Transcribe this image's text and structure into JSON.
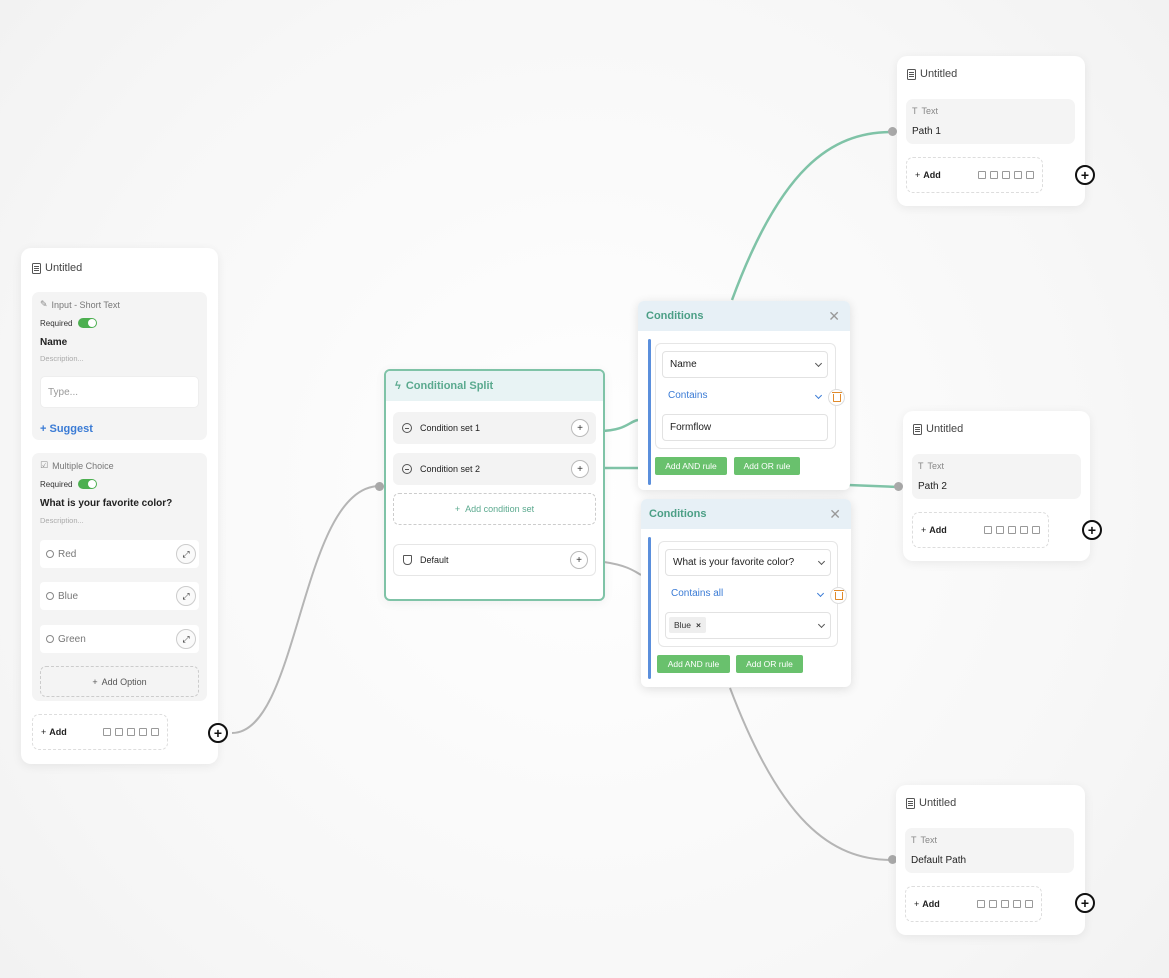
{
  "left_card": {
    "title": "Untitled",
    "input_block": {
      "type_label": "Input - Short Text",
      "required_label": "Required",
      "field_name": "Name",
      "description_placeholder": "Description...",
      "answer_placeholder": "Type...",
      "suggest_label": "+ Suggest"
    },
    "choice_block": {
      "type_label": "Multiple Choice",
      "required_label": "Required",
      "question": "What is your favorite color?",
      "description_placeholder": "Description...",
      "options": [
        "Red",
        "Blue",
        "Green"
      ],
      "add_option_label": "Add Option"
    },
    "add_label": "Add"
  },
  "split": {
    "title": "Conditional Split",
    "condition_sets": [
      "Condition set 1",
      "Condition set 2"
    ],
    "add_condition_set_label": "Add condition set",
    "default_label": "Default"
  },
  "conditions_1": {
    "title": "Conditions",
    "field": "Name",
    "operator": "Contains",
    "value": "Formflow",
    "add_and": "Add AND rule",
    "add_or": "Add OR rule"
  },
  "conditions_2": {
    "title": "Conditions",
    "field": "What is your favorite color?",
    "operator": "Contains all",
    "tag": "Blue",
    "add_and": "Add AND rule",
    "add_or": "Add OR rule"
  },
  "path_cards": [
    {
      "title": "Untitled",
      "type_label": "Text",
      "value": "Path 1",
      "add_label": "Add"
    },
    {
      "title": "Untitled",
      "type_label": "Text",
      "value": "Path 2",
      "add_label": "Add"
    },
    {
      "title": "Untitled",
      "type_label": "Text",
      "value": "Default Path",
      "add_label": "Add"
    }
  ],
  "colors": {
    "accent_green": "#7fc3a7",
    "button_green": "#69c16d",
    "link_blue": "#3a7bd5",
    "edge_grey": "#b5b5b5"
  }
}
